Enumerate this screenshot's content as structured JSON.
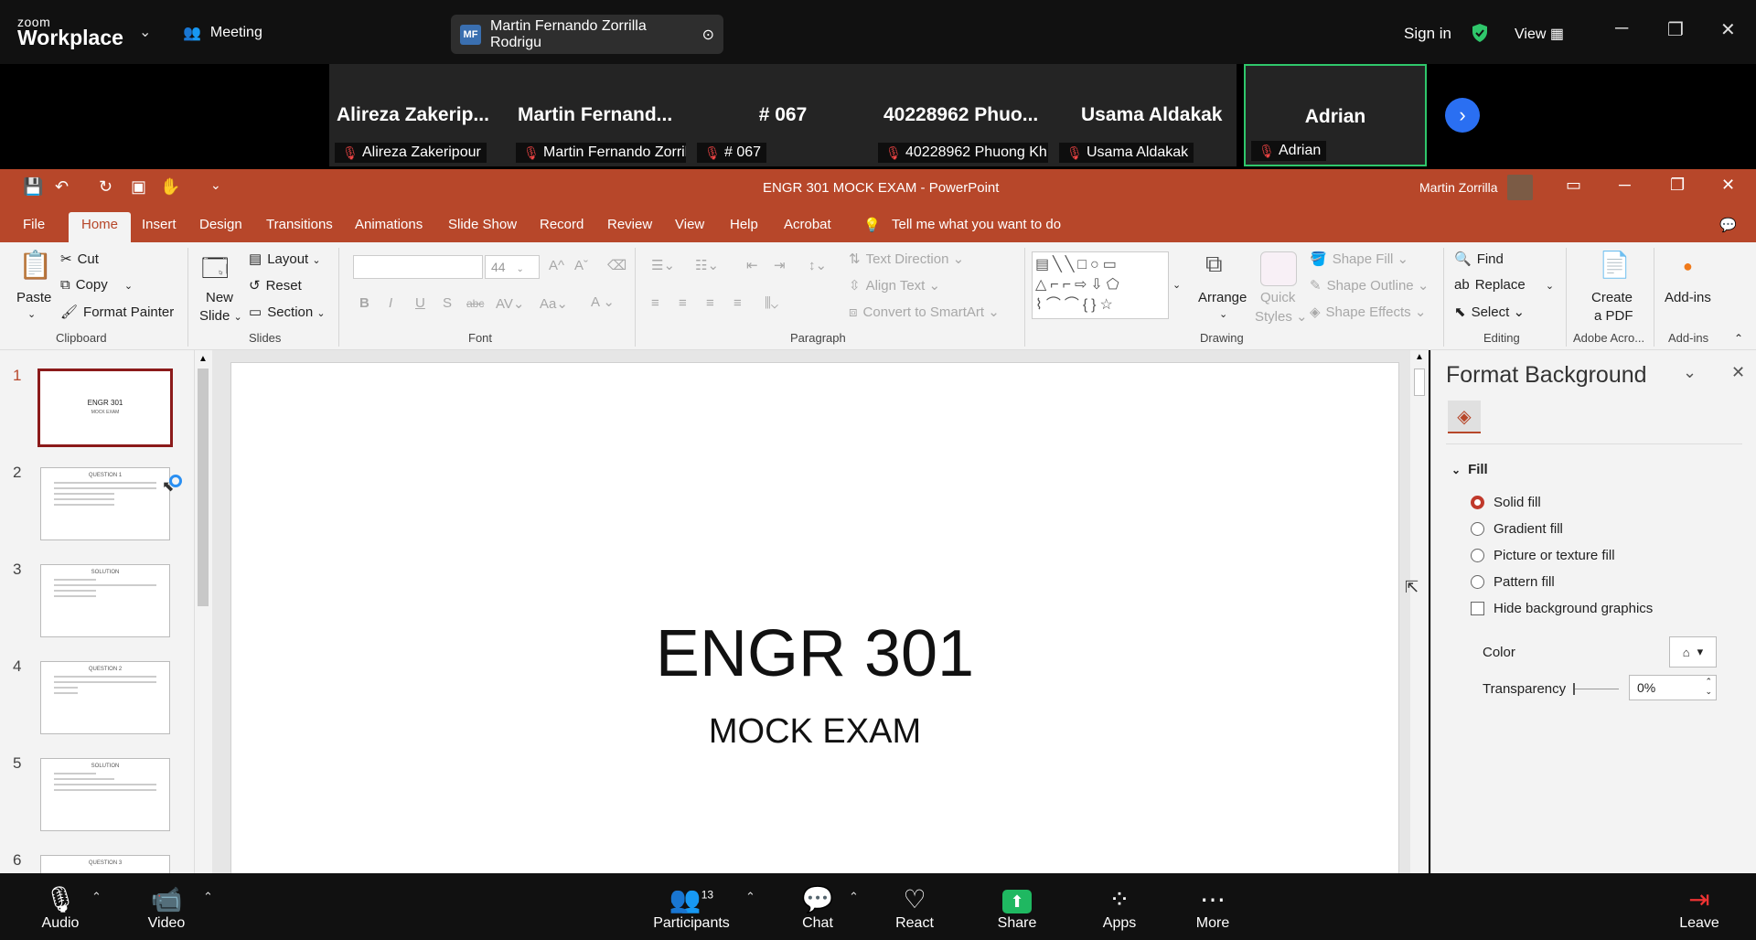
{
  "zoom": {
    "brand_small": "zoom",
    "brand_big": "Workplace",
    "meeting_label": "Meeting",
    "host_initials": "MF",
    "host_name": "Martin Fernando Zorrilla Rodrigu",
    "sign_in": "Sign in",
    "view_label": "View",
    "participants_tiles": [
      {
        "big": "Alireza  Zakerip...",
        "small": "Alireza Zakeripour"
      },
      {
        "big": "Martin  Fernand...",
        "small": "Martin Fernando Zorrilla ..."
      },
      {
        "big": "# 067",
        "small": "# 067"
      },
      {
        "big": "40228962  Phuo...",
        "small": "40228962 Phuong Kh..."
      },
      {
        "big": "Usama Aldakak",
        "small": "Usama Aldakak"
      },
      {
        "big": "Adrian",
        "small": "Adrian"
      }
    ],
    "bottom": {
      "audio": "Audio",
      "video": "Video",
      "participants": "Participants",
      "participants_count": "13",
      "chat": "Chat",
      "react": "React",
      "share": "Share",
      "apps": "Apps",
      "more": "More",
      "leave": "Leave"
    }
  },
  "ppt": {
    "doc_title": "ENGR 301 MOCK EXAM  -  PowerPoint",
    "user": "Martin Zorrilla",
    "tabs": [
      "File",
      "Home",
      "Insert",
      "Design",
      "Transitions",
      "Animations",
      "Slide Show",
      "Record",
      "Review",
      "View",
      "Help",
      "Acrobat"
    ],
    "tell_me": "Tell me what you want to do",
    "clipboard": {
      "paste": "Paste",
      "cut": "Cut",
      "copy": "Copy",
      "format_painter": "Format Painter",
      "group": "Clipboard"
    },
    "slides_group": {
      "new": "New",
      "slide": "Slide",
      "layout": "Layout",
      "reset": "Reset",
      "section": "Section",
      "group": "Slides"
    },
    "font_group": {
      "size": "44",
      "group": "Font"
    },
    "paragraph_group": {
      "text_direction": "Text Direction",
      "align_text": "Align Text",
      "smartart": "Convert to SmartArt",
      "group": "Paragraph"
    },
    "drawing_group": {
      "arrange": "Arrange",
      "quick": "Quick",
      "styles": "Styles",
      "shape_fill": "Shape Fill",
      "shape_outline": "Shape Outline",
      "shape_effects": "Shape Effects",
      "group": "Drawing"
    },
    "editing_group": {
      "find": "Find",
      "replace": "Replace",
      "select": "Select",
      "group": "Editing"
    },
    "acrobat_group": {
      "create": "Create",
      "pdf": "a PDF",
      "group": "Adobe Acro..."
    },
    "addins_group": {
      "label": "Add-ins",
      "group": "Add-ins"
    },
    "thumbs": [
      {
        "num": "1",
        "title": "ENGR 301",
        "sub": "MOCK EXAM"
      },
      {
        "num": "2",
        "title": "QUESTION 1",
        "sub": ""
      },
      {
        "num": "3",
        "title": "SOLUTION",
        "sub": ""
      },
      {
        "num": "4",
        "title": "QUESTION 2",
        "sub": ""
      },
      {
        "num": "5",
        "title": "SOLUTION",
        "sub": ""
      },
      {
        "num": "6",
        "title": "QUESTION 3",
        "sub": ""
      }
    ],
    "slide": {
      "title": "ENGR 301",
      "subtitle": "MOCK EXAM"
    },
    "format_bg": {
      "header": "Format Background",
      "fill_section": "Fill",
      "options": [
        "Solid fill",
        "Gradient fill",
        "Picture or texture fill",
        "Pattern fill"
      ],
      "selected": "Solid fill",
      "hide_bg": "Hide background graphics",
      "color_label": "Color",
      "transparency_label": "Transparency",
      "transparency_value": "0%"
    }
  },
  "colors": {
    "ppt_red": "#b7472a",
    "zoom_green": "#2fc76b",
    "zoom_blue": "#2a6ff2"
  }
}
